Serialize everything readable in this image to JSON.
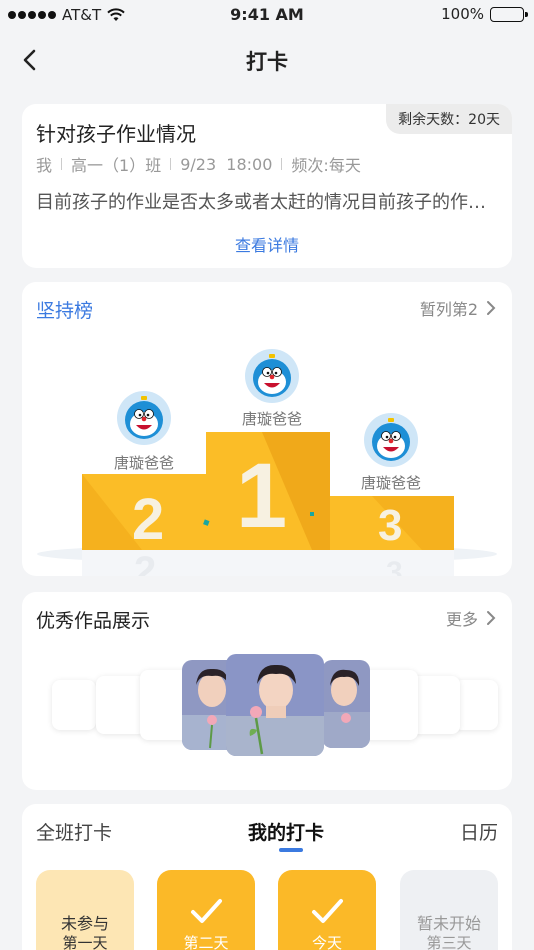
{
  "status_bar": {
    "carrier": "AT&T",
    "time": "9:41 AM",
    "battery": "100%"
  },
  "nav": {
    "title": "打卡"
  },
  "task": {
    "remaining_label": "剩余天数：20天",
    "title": "针对孩子作业情况",
    "meta": [
      "我",
      "高一（1）班",
      "9/23  18:00",
      "频次:每天"
    ],
    "description": "目前孩子的作业是否太多或者太赶的情况目前孩子的作业是否太多或者太赶的情况",
    "detail_link": "查看详情"
  },
  "ranking": {
    "title": "坚持榜",
    "position": "暂列第2",
    "first": {
      "name": "唐璇爸爸",
      "place": "1"
    },
    "second": {
      "name": "唐璇爸爸",
      "place": "2"
    },
    "third": {
      "name": "唐璇爸爸",
      "place": "3"
    }
  },
  "works": {
    "title": "优秀作品展示",
    "more": "更多"
  },
  "checkin": {
    "tabs": [
      "全班打卡",
      "我的打卡",
      "日历"
    ],
    "days": [
      {
        "line1": "未参与",
        "line2": "第一天",
        "state": "missed"
      },
      {
        "line1": "",
        "line2": "第二天",
        "state": "done"
      },
      {
        "line1": "",
        "line2": "今天",
        "state": "done"
      },
      {
        "line1": "暂未开始",
        "line2": "第三天",
        "state": "pending"
      }
    ]
  },
  "colors": {
    "accent": "#3b7ae0",
    "gold": "#fbbd27",
    "gold_dark": "#f0a91a"
  }
}
